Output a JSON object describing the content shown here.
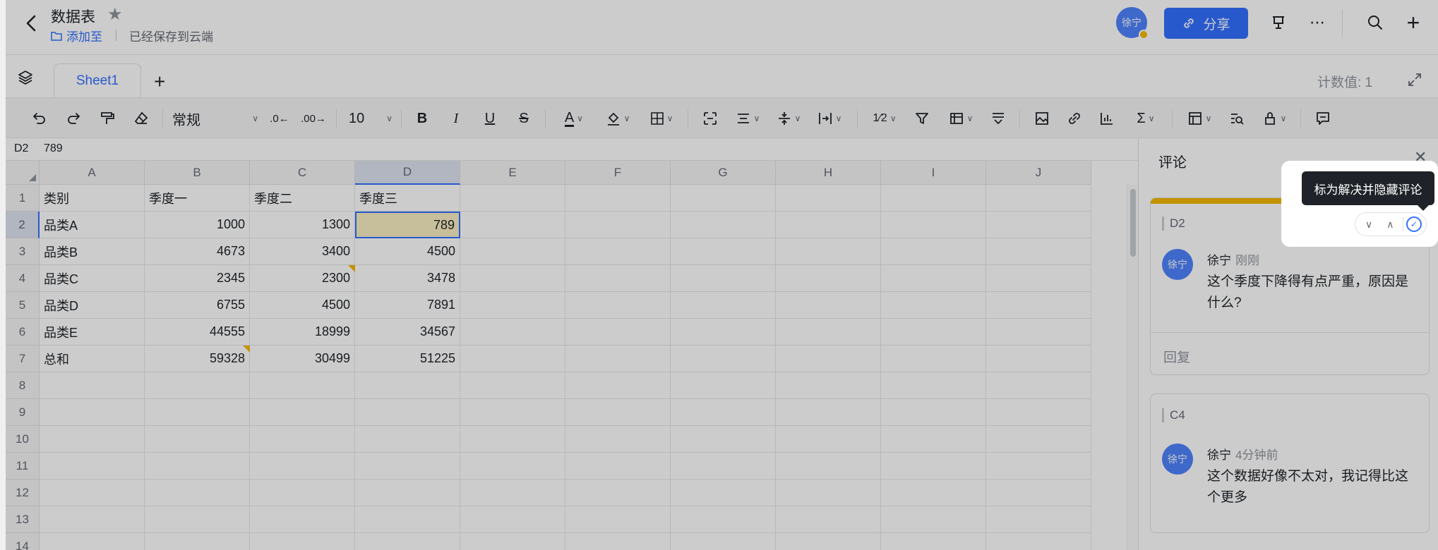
{
  "header": {
    "doc_title": "数据表",
    "add_to_label": "添加至",
    "saved_status": "已经保存到云端",
    "user_initials": "徐宁",
    "share_label": "分享"
  },
  "tabs": {
    "sheet_name": "Sheet1",
    "count_label": "计数值: 1"
  },
  "toolbar": {
    "format_label": "常规",
    "font_size": "10"
  },
  "formula_bar": {
    "cell_ref": "D2",
    "value": "789"
  },
  "grid": {
    "columns": [
      "A",
      "B",
      "C",
      "D",
      "E",
      "F",
      "G",
      "H",
      "I",
      "J"
    ],
    "rows": [
      "1",
      "2",
      "3",
      "4",
      "5",
      "6",
      "7",
      "8",
      "9",
      "10",
      "11",
      "12",
      "13",
      "14"
    ],
    "headers": [
      "类别",
      "季度一",
      "季度二",
      "季度三"
    ],
    "data": [
      [
        "品类A",
        "1000",
        "1300",
        "789"
      ],
      [
        "品类B",
        "4673",
        "3400",
        "4500"
      ],
      [
        "品类C",
        "2345",
        "2300",
        "3478"
      ],
      [
        "品类D",
        "6755",
        "4500",
        "7891"
      ],
      [
        "品类E",
        "44555",
        "18999",
        "34567"
      ],
      [
        "总和",
        "59328",
        "30499",
        "51225"
      ]
    ]
  },
  "comments": {
    "panel_title": "评论",
    "tooltip": "标为解决并隐藏评论",
    "threads": [
      {
        "cell": "D2",
        "author": "徐宁",
        "time": "刚刚",
        "text": "这个季度下降得有点严重，原因是什么?",
        "reply_placeholder": "回复"
      },
      {
        "cell": "C4",
        "author": "徐宁",
        "time": "4分钟前",
        "text": "这个数据好像不太对，我记得比这个更多"
      }
    ]
  },
  "colors": {
    "accent": "#3370ff",
    "comment_flag": "#f5b800",
    "active_cell_fill": "#f9eec2"
  }
}
